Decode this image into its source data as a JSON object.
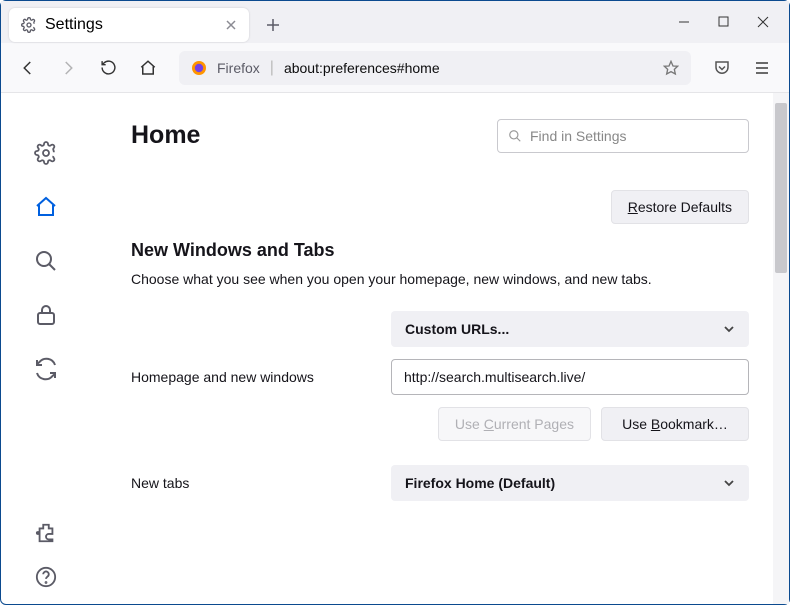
{
  "tab": {
    "title": "Settings"
  },
  "urlbar": {
    "identity": "Firefox",
    "url": "about:preferences#home"
  },
  "search": {
    "placeholder": "Find in Settings"
  },
  "page": {
    "title": "Home",
    "restore_btn": "Restore Defaults",
    "section_title": "New Windows and Tabs",
    "section_desc": "Choose what you see when you open your homepage, new windows, and new tabs.",
    "homepage_label": "Homepage and new windows",
    "homepage_mode": "Custom URLs...",
    "homepage_url": "http://search.multisearch.live/",
    "use_current": "Use Current Pages",
    "use_bookmark": "Use Bookmark…",
    "newtabs_label": "New tabs",
    "newtabs_mode": "Firefox Home (Default)"
  },
  "restore_accesskey": "R",
  "use_current_accesskey": "C",
  "use_bookmark_accesskey": "B"
}
